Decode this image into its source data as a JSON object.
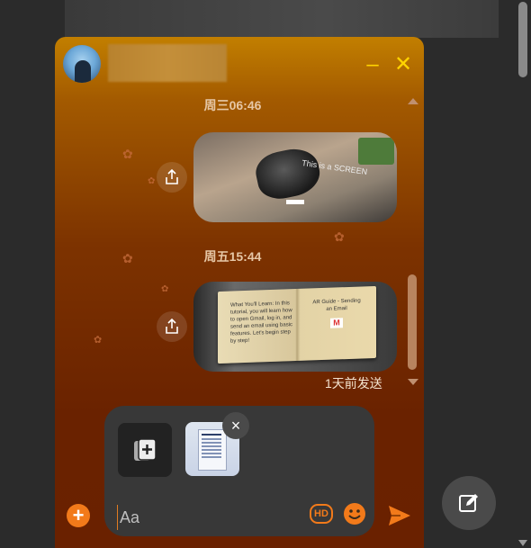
{
  "header": {
    "minimize_label": "–",
    "close_label": "✕"
  },
  "timestamps": [
    "周三06:46",
    "周五15:44"
  ],
  "messages": [
    {
      "type": "image",
      "caption": "This is a SCREEN"
    },
    {
      "type": "image",
      "book_left": "What You'll Learn: In this tutorial, you will learn how to open Gmail, log in, and send an email using basic features. Let's begin step by step!",
      "book_right": "AR Guide - Sending an Email",
      "status": "1天前发送"
    }
  ],
  "composer": {
    "placeholder": "Aa",
    "hd_label": "HD",
    "remove_label": "×",
    "plus_label": "+"
  },
  "colors": {
    "accent": "#f27a1a",
    "header_icons": "#ffd400"
  },
  "icons": [
    "share-icon",
    "add-image-icon",
    "emoji-icon",
    "send-icon",
    "edit-icon"
  ]
}
